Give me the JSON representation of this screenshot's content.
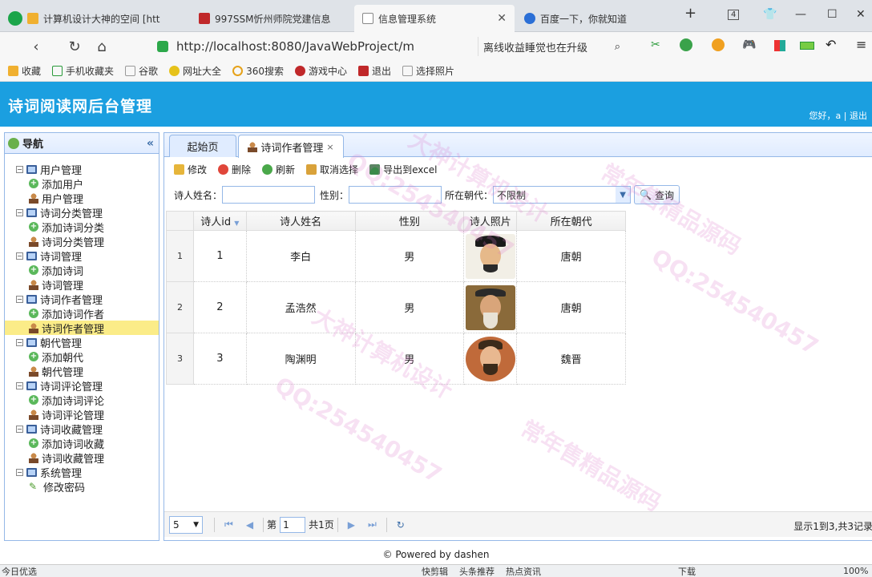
{
  "browser": {
    "tabs": [
      {
        "label": "计算机设计大神的空间 [htt",
        "active": false
      },
      {
        "label": "997SSM忻州师院党建信息",
        "active": false
      },
      {
        "label": "信息管理系统",
        "active": true
      },
      {
        "label": "百度一下，你就知道",
        "active": false
      }
    ],
    "new_tab": "+",
    "tab_count": "4",
    "url": "http://localhost:8080/JavaWebProject/m",
    "side_search": "离线收益睡觉也在升级",
    "favorites": [
      "收藏",
      "手机收藏夹",
      "谷歌",
      "网址大全",
      "360搜索",
      "游戏中心",
      "退出",
      "选择照片"
    ]
  },
  "app": {
    "title": "诗词阅读网后台管理",
    "greeting": "您好，a | 退出",
    "accent": "#1b9fe0"
  },
  "nav": {
    "title": "导航",
    "groups": [
      {
        "label": "用户管理",
        "children": [
          {
            "label": "添加用户",
            "icon": "add"
          },
          {
            "label": "用户管理",
            "icon": "user"
          }
        ]
      },
      {
        "label": "诗词分类管理",
        "children": [
          {
            "label": "添加诗词分类",
            "icon": "add"
          },
          {
            "label": "诗词分类管理",
            "icon": "user"
          }
        ]
      },
      {
        "label": "诗词管理",
        "children": [
          {
            "label": "添加诗词",
            "icon": "add"
          },
          {
            "label": "诗词管理",
            "icon": "user"
          }
        ]
      },
      {
        "label": "诗词作者管理",
        "children": [
          {
            "label": "添加诗词作者",
            "icon": "add"
          },
          {
            "label": "诗词作者管理",
            "icon": "user",
            "selected": true
          }
        ]
      },
      {
        "label": "朝代管理",
        "children": [
          {
            "label": "添加朝代",
            "icon": "add"
          },
          {
            "label": "朝代管理",
            "icon": "user"
          }
        ]
      },
      {
        "label": "诗词评论管理",
        "children": [
          {
            "label": "添加诗词评论",
            "icon": "add"
          },
          {
            "label": "诗词评论管理",
            "icon": "user"
          }
        ]
      },
      {
        "label": "诗词收藏管理",
        "children": [
          {
            "label": "添加诗词收藏",
            "icon": "add"
          },
          {
            "label": "诗词收藏管理",
            "icon": "user"
          }
        ]
      },
      {
        "label": "系统管理",
        "children": [
          {
            "label": "修改密码",
            "icon": "pen"
          }
        ]
      }
    ]
  },
  "page_tabs": [
    {
      "label": "起始页"
    },
    {
      "label": "诗词作者管理",
      "close": "×"
    }
  ],
  "toolbar": {
    "edit": "修改",
    "delete": "删除",
    "refresh": "刷新",
    "unselect": "取消选择",
    "export": "导出到excel"
  },
  "search": {
    "name_label": "诗人姓名：",
    "gender_label": "性别：",
    "dynasty_label": "所在朝代：",
    "dynasty_value": "不限制",
    "query": "查询"
  },
  "grid": {
    "columns": [
      "诗人id",
      "诗人姓名",
      "性别",
      "诗人照片",
      "所在朝代"
    ],
    "rows": [
      {
        "rownum": "1",
        "id": "1",
        "name": "李白",
        "gender": "男",
        "dynasty": "唐朝"
      },
      {
        "rownum": "2",
        "id": "2",
        "name": "孟浩然",
        "gender": "男",
        "dynasty": "唐朝"
      },
      {
        "rownum": "3",
        "id": "3",
        "name": "陶渊明",
        "gender": "男",
        "dynasty": "魏晋"
      }
    ]
  },
  "pager": {
    "page_size": "5",
    "page_prefix": "第",
    "page_value": "1",
    "page_total": "共1页",
    "info": "显示1到3,共3记录"
  },
  "footer": "© Powered by dashen",
  "statusbar": {
    "left": "今日优选",
    "items": [
      "快剪辑",
      "头条推荐",
      "热点资讯",
      "下载",
      "100%"
    ]
  },
  "watermarks": [
    "QQ:254540457",
    "大神计算机设计",
    "常年售精品源码"
  ]
}
